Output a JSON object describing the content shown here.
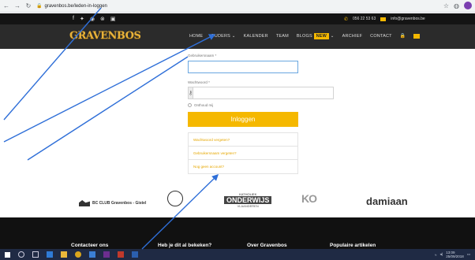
{
  "browser": {
    "url": "gravenbos.be/leden-in-loggen",
    "nav_icons": [
      "back-icon",
      "forward-icon",
      "reload-icon"
    ]
  },
  "topbar": {
    "social_icons": [
      "facebook-icon",
      "twitter-icon",
      "instagram-icon",
      "pinterest-icon",
      "youtube-icon"
    ],
    "phone": "056 22 53 63",
    "email": "info@gravenbos.be"
  },
  "header": {
    "logo": "GRAVENBOS",
    "menu": [
      {
        "label": "HOME"
      },
      {
        "label": "OUDERS ⌄"
      },
      {
        "label": "KALENDER"
      },
      {
        "label": "TEAM"
      },
      {
        "label": "BLOGS"
      },
      {
        "label": "ARCHIEF"
      },
      {
        "label": "CONTACT"
      }
    ],
    "blogs_badge": "NEW"
  },
  "login": {
    "username_label": "Gebruikersnaam *",
    "password_label": "Wachtwoord *",
    "remember_label": "Onthoud mij",
    "submit_label": "Inloggen",
    "links": [
      "Wachtwoord vergeten?",
      "Gebruikersnaam vergeten?",
      "Nog geen account?"
    ]
  },
  "partners": {
    "bcg_label": "BC CLUB Gravenbos - Gistel",
    "kath_top": "KATHOLIEK",
    "kath_main": "ONDERWIJS",
    "kath_bottom": "VLAANDEREN",
    "kh_label": "KO",
    "damiaan_label": "damiaan"
  },
  "footer": {
    "col1": "Contacteer ons",
    "col2": "Heb je dit al bekeken?",
    "col3": "Over Gravenbos",
    "col4": "Populaire artikelen"
  },
  "taskbar": {
    "time": "13:09",
    "date": "25/09/2018"
  }
}
